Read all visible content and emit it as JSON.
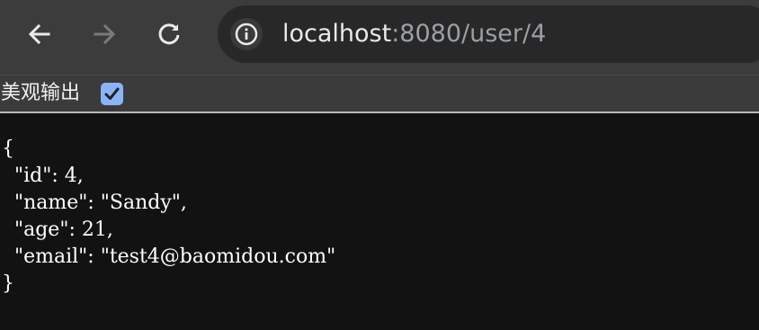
{
  "browser": {
    "url_host": "localhost",
    "url_rest": ":8080/user/4",
    "back_icon": "arrow-left-icon",
    "forward_icon": "arrow-right-icon",
    "reload_icon": "reload-icon",
    "site_info_icon": "info-icon"
  },
  "viewer": {
    "pretty_print_label": "美观输出",
    "pretty_print_checked": true
  },
  "json": {
    "open_brace": "{",
    "close_brace": "}",
    "lines": [
      "  \"id\": 4,",
      "  \"name\": \"Sandy\",",
      "  \"age\": 21,",
      "  \"email\": \"test4@baomidou.com\""
    ]
  },
  "colors": {
    "toolbar": "#3c3c3c",
    "omnibox": "#282828",
    "page_background": "#121212",
    "checkbox_accent": "#8ab4f8"
  }
}
